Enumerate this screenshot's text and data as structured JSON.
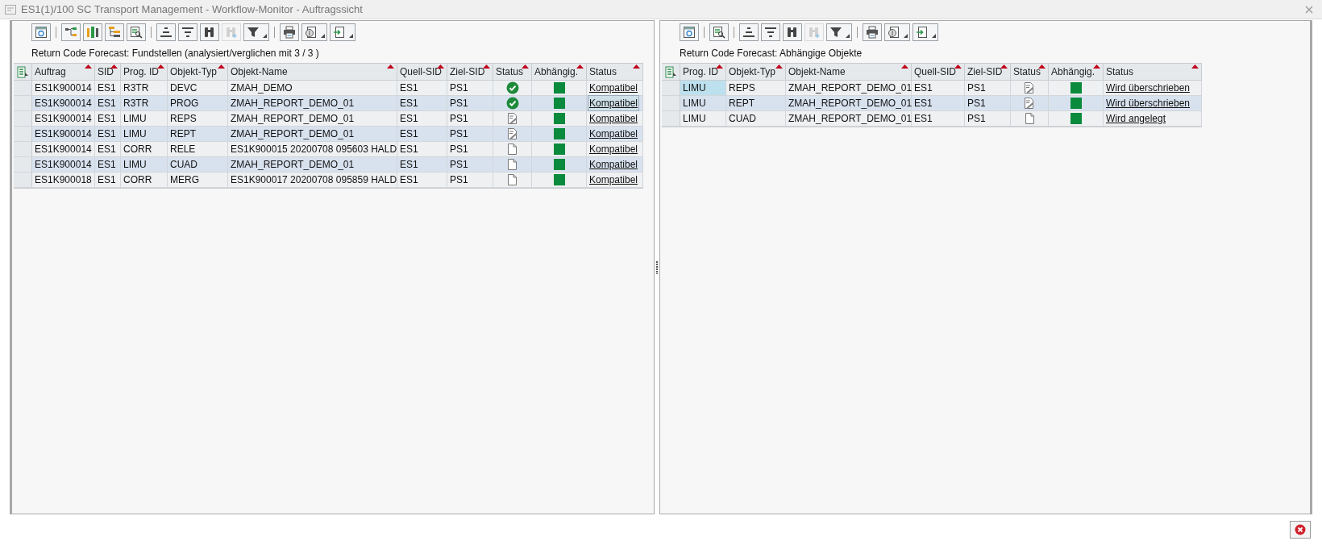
{
  "window": {
    "title": "ES1(1)/100 SC Transport Management - Workflow-Monitor - Auftragssicht"
  },
  "left_panel": {
    "toolbar_groups": [
      {
        "buttons": [
          {
            "kind": "refresh",
            "disabled": false,
            "menu": false
          }
        ]
      },
      {
        "buttons": [
          {
            "kind": "tree",
            "disabled": false,
            "menu": false
          },
          {
            "kind": "columns",
            "disabled": false,
            "menu": false
          },
          {
            "kind": "hierarchy",
            "disabled": false,
            "menu": false
          },
          {
            "kind": "detail",
            "disabled": false,
            "menu": false
          }
        ]
      },
      {
        "buttons": [
          {
            "kind": "sort_up",
            "disabled": false,
            "menu": false
          },
          {
            "kind": "sort_down",
            "disabled": false,
            "menu": false
          },
          {
            "kind": "find",
            "disabled": false,
            "menu": false
          },
          {
            "kind": "find_next",
            "disabled": true,
            "menu": false
          },
          {
            "kind": "filter",
            "disabled": false,
            "menu": true
          }
        ]
      },
      {
        "buttons": [
          {
            "kind": "print",
            "disabled": false,
            "menu": false
          },
          {
            "kind": "view",
            "disabled": false,
            "menu": true
          },
          {
            "kind": "export",
            "disabled": false,
            "menu": true
          }
        ]
      }
    ],
    "heading": "Return Code Forecast: Fundstellen (analysiert/verglichen mit 3 / 3 )",
    "columns": [
      "Auftrag",
      "SID",
      "Prog. ID",
      "Objekt-Typ",
      "Objekt-Name",
      "Quell-SID",
      "Ziel-SID",
      "Status",
      "Abhängig.",
      "Status"
    ],
    "rows": [
      {
        "cells": [
          "ES1K900014",
          "ES1",
          "R3TR",
          "DEVC",
          "ZMAH_DEMO",
          "ES1",
          "PS1"
        ],
        "kind": "ok",
        "result": "Kompatibel",
        "focused": false
      },
      {
        "cells": [
          "ES1K900014",
          "ES1",
          "R3TR",
          "PROG",
          "ZMAH_REPORT_DEMO_01",
          "ES1",
          "PS1"
        ],
        "kind": "ok",
        "result": "Kompatibel",
        "focused": true
      },
      {
        "cells": [
          "ES1K900014",
          "ES1",
          "LIMU",
          "REPS",
          "ZMAH_REPORT_DEMO_01",
          "ES1",
          "PS1"
        ],
        "kind": "changed",
        "result": "Kompatibel",
        "focused": false
      },
      {
        "cells": [
          "ES1K900014",
          "ES1",
          "LIMU",
          "REPT",
          "ZMAH_REPORT_DEMO_01",
          "ES1",
          "PS1"
        ],
        "kind": "changed",
        "result": "Kompatibel",
        "focused": false
      },
      {
        "cells": [
          "ES1K900014",
          "ES1",
          "CORR",
          "RELE",
          "ES1K900015 20200708 095603 HALD",
          "ES1",
          "PS1"
        ],
        "kind": "new",
        "result": "Kompatibel",
        "focused": false
      },
      {
        "cells": [
          "ES1K900014",
          "ES1",
          "LIMU",
          "CUAD",
          "ZMAH_REPORT_DEMO_01",
          "ES1",
          "PS1"
        ],
        "kind": "new",
        "result": "Kompatibel",
        "focused": false
      },
      {
        "cells": [
          "ES1K900018",
          "ES1",
          "CORR",
          "MERG",
          "ES1K900017 20200708 095859 HALD",
          "ES1",
          "PS1"
        ],
        "kind": "new",
        "result": "Kompatibel",
        "focused": false
      }
    ]
  },
  "right_panel": {
    "toolbar_groups": [
      {
        "buttons": [
          {
            "kind": "refresh",
            "disabled": false,
            "menu": false
          }
        ]
      },
      {
        "buttons": [
          {
            "kind": "detail",
            "disabled": false,
            "menu": false
          }
        ]
      },
      {
        "buttons": [
          {
            "kind": "sort_up",
            "disabled": false,
            "menu": false
          },
          {
            "kind": "sort_down",
            "disabled": false,
            "menu": false
          },
          {
            "kind": "find",
            "disabled": false,
            "menu": false
          },
          {
            "kind": "find_next",
            "disabled": true,
            "menu": false
          },
          {
            "kind": "filter",
            "disabled": false,
            "menu": true
          }
        ]
      },
      {
        "buttons": [
          {
            "kind": "print",
            "disabled": false,
            "menu": false
          },
          {
            "kind": "view",
            "disabled": false,
            "menu": true
          },
          {
            "kind": "export",
            "disabled": false,
            "menu": true
          }
        ]
      }
    ],
    "heading": "Return Code Forecast: Abhängige Objekte",
    "columns": [
      "Prog. ID",
      "Objekt-Typ",
      "Objekt-Name",
      "Quell-SID",
      "Ziel-SID",
      "Status",
      "Abhängig.",
      "Status"
    ],
    "rows": [
      {
        "cells": [
          "LIMU",
          "REPS",
          "ZMAH_REPORT_DEMO_01",
          "ES1",
          "PS1"
        ],
        "kind": "changed",
        "result": "Wird überschrieben",
        "focused": true
      },
      {
        "cells": [
          "LIMU",
          "REPT",
          "ZMAH_REPORT_DEMO_01",
          "ES1",
          "PS1"
        ],
        "kind": "changed",
        "result": "Wird überschrieben",
        "focused": false
      },
      {
        "cells": [
          "LIMU",
          "CUAD",
          "ZMAH_REPORT_DEMO_01",
          "ES1",
          "PS1"
        ],
        "kind": "new",
        "result": "Wird angelegt",
        "focused": false
      }
    ]
  }
}
